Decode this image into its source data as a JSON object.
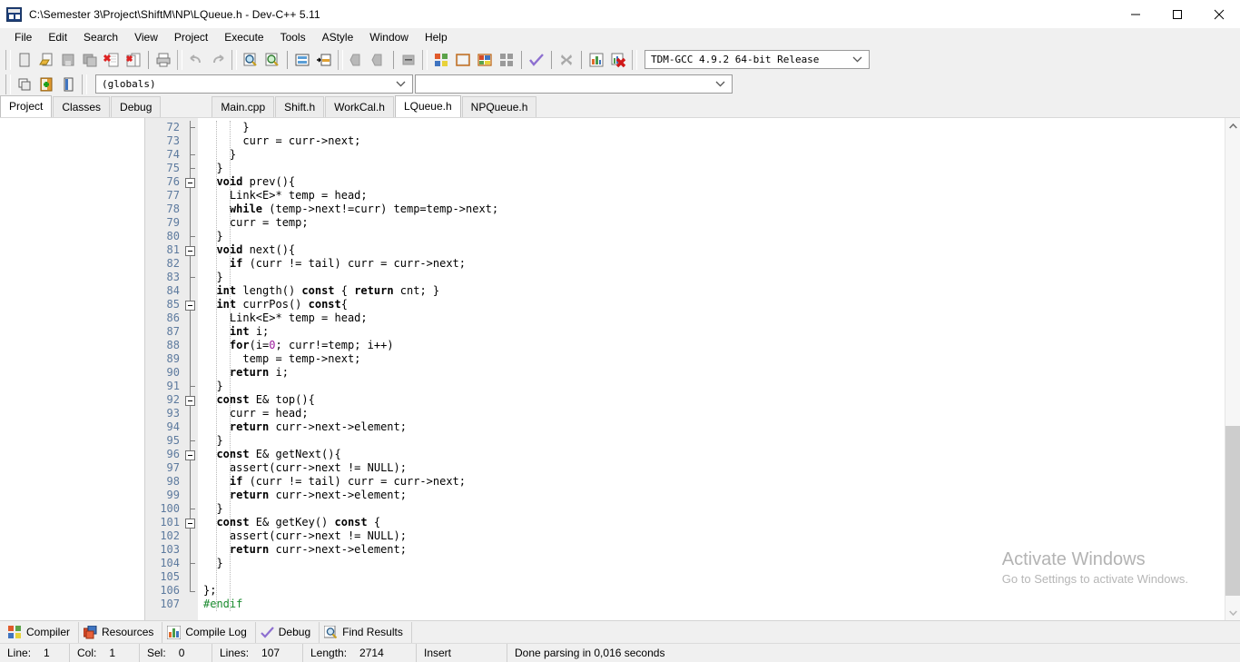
{
  "window": {
    "title": "C:\\Semester 3\\Project\\ShiftM\\NP\\LQueue.h - Dev-C++ 5.11",
    "app_icon": "devcpp-icon",
    "minimize": "minimize-icon",
    "maximize": "maximize-icon",
    "close": "close-icon"
  },
  "menu": {
    "items": [
      {
        "label": "File"
      },
      {
        "label": "Edit"
      },
      {
        "label": "Search"
      },
      {
        "label": "View"
      },
      {
        "label": "Project"
      },
      {
        "label": "Execute"
      },
      {
        "label": "Tools"
      },
      {
        "label": "AStyle"
      },
      {
        "label": "Window"
      },
      {
        "label": "Help"
      }
    ]
  },
  "toolbar1": {
    "buttons": [
      {
        "name": "new-file-icon"
      },
      {
        "name": "open-file-icon"
      },
      {
        "name": "save-file-icon"
      },
      {
        "name": "save-all-icon"
      },
      {
        "name": "close-file-icon"
      },
      {
        "name": "close-all-icon"
      },
      {
        "name": "print-icon"
      },
      {
        "name": "undo-icon"
      },
      {
        "name": "redo-icon"
      },
      {
        "name": "find-icon"
      },
      {
        "name": "replace-icon"
      },
      {
        "name": "goto-line-icon"
      },
      {
        "name": "goto-function-icon"
      },
      {
        "name": "back-icon"
      },
      {
        "name": "forward-icon"
      },
      {
        "name": "toggle-breakpoint-icon"
      },
      {
        "name": "compile-icon"
      },
      {
        "name": "run-icon"
      },
      {
        "name": "compile-and-run-icon"
      },
      {
        "name": "rebuild-all-icon"
      },
      {
        "name": "syntax-check-icon"
      },
      {
        "name": "stop-execution-icon"
      },
      {
        "name": "profile-icon"
      },
      {
        "name": "delete-profile-icon"
      }
    ]
  },
  "toolbar2": {
    "buttons": [
      {
        "name": "new-project-icon"
      },
      {
        "name": "add-to-project-icon"
      },
      {
        "name": "project-options-icon"
      }
    ],
    "scope_combo": {
      "value": "(globals)",
      "arrow": "chevron-down-icon"
    },
    "symbol_combo": {
      "value": "",
      "arrow": "chevron-down-icon"
    },
    "compiler_combo": {
      "value": "TDM-GCC 4.9.2 64-bit Release",
      "arrow": "chevron-down-icon"
    }
  },
  "panel_tabs": {
    "items": [
      {
        "label": "Project",
        "active": true
      },
      {
        "label": "Classes",
        "active": false
      },
      {
        "label": "Debug",
        "active": false
      }
    ]
  },
  "editor_tabs": {
    "items": [
      {
        "label": "Main.cpp",
        "active": false
      },
      {
        "label": "Shift.h",
        "active": false
      },
      {
        "label": "WorkCal.h",
        "active": false
      },
      {
        "label": "LQueue.h",
        "active": true
      },
      {
        "label": "NPQueue.h",
        "active": false
      }
    ]
  },
  "editor": {
    "first_line": 72,
    "lines": [
      {
        "n": 72,
        "fold": "tick",
        "tokens": [
          {
            "t": "      }",
            "c": "id"
          }
        ]
      },
      {
        "n": 73,
        "fold": "line",
        "tokens": [
          {
            "t": "      curr = curr->next;",
            "c": "id"
          }
        ]
      },
      {
        "n": 74,
        "fold": "tick",
        "tokens": [
          {
            "t": "    }",
            "c": "id"
          }
        ]
      },
      {
        "n": 75,
        "fold": "tick",
        "tokens": [
          {
            "t": "  }",
            "c": "id"
          }
        ]
      },
      {
        "n": 76,
        "fold": "box",
        "tokens": [
          {
            "t": "  ",
            "c": "id"
          },
          {
            "t": "void",
            "c": "kw"
          },
          {
            "t": " prev(){",
            "c": "id"
          }
        ]
      },
      {
        "n": 77,
        "fold": "line",
        "tokens": [
          {
            "t": "    Link<E>* temp = head;",
            "c": "id"
          }
        ]
      },
      {
        "n": 78,
        "fold": "line",
        "tokens": [
          {
            "t": "    ",
            "c": "id"
          },
          {
            "t": "while",
            "c": "kw"
          },
          {
            "t": " (temp->next!=curr) temp=temp->next;",
            "c": "id"
          }
        ]
      },
      {
        "n": 79,
        "fold": "line",
        "tokens": [
          {
            "t": "    curr = temp;",
            "c": "id"
          }
        ]
      },
      {
        "n": 80,
        "fold": "tick",
        "tokens": [
          {
            "t": "  }",
            "c": "id"
          }
        ]
      },
      {
        "n": 81,
        "fold": "box",
        "tokens": [
          {
            "t": "  ",
            "c": "id"
          },
          {
            "t": "void",
            "c": "kw"
          },
          {
            "t": " next(){",
            "c": "id"
          }
        ]
      },
      {
        "n": 82,
        "fold": "line",
        "tokens": [
          {
            "t": "    ",
            "c": "id"
          },
          {
            "t": "if",
            "c": "kw"
          },
          {
            "t": " (curr != tail) curr = curr->next;",
            "c": "id"
          }
        ]
      },
      {
        "n": 83,
        "fold": "tick",
        "tokens": [
          {
            "t": "  }",
            "c": "id"
          }
        ]
      },
      {
        "n": 84,
        "fold": "line",
        "tokens": [
          {
            "t": "  ",
            "c": "id"
          },
          {
            "t": "int",
            "c": "kw"
          },
          {
            "t": " length() ",
            "c": "id"
          },
          {
            "t": "const",
            "c": "kw"
          },
          {
            "t": " { ",
            "c": "id"
          },
          {
            "t": "return",
            "c": "kw"
          },
          {
            "t": " cnt; }",
            "c": "id"
          }
        ]
      },
      {
        "n": 85,
        "fold": "box",
        "tokens": [
          {
            "t": "  ",
            "c": "id"
          },
          {
            "t": "int",
            "c": "kw"
          },
          {
            "t": " currPos() ",
            "c": "id"
          },
          {
            "t": "const",
            "c": "kw"
          },
          {
            "t": "{",
            "c": "id"
          }
        ]
      },
      {
        "n": 86,
        "fold": "line",
        "tokens": [
          {
            "t": "    Link<E>* temp = head;",
            "c": "id"
          }
        ]
      },
      {
        "n": 87,
        "fold": "line",
        "tokens": [
          {
            "t": "    ",
            "c": "id"
          },
          {
            "t": "int",
            "c": "kw"
          },
          {
            "t": " i;",
            "c": "id"
          }
        ]
      },
      {
        "n": 88,
        "fold": "line",
        "tokens": [
          {
            "t": "    ",
            "c": "id"
          },
          {
            "t": "for",
            "c": "kw"
          },
          {
            "t": "(i=",
            "c": "id"
          },
          {
            "t": "0",
            "c": "num"
          },
          {
            "t": "; curr!=temp; i++)",
            "c": "id"
          }
        ]
      },
      {
        "n": 89,
        "fold": "line",
        "tokens": [
          {
            "t": "      temp = temp->next;",
            "c": "id"
          }
        ]
      },
      {
        "n": 90,
        "fold": "line",
        "tokens": [
          {
            "t": "    ",
            "c": "id"
          },
          {
            "t": "return",
            "c": "kw"
          },
          {
            "t": " i;",
            "c": "id"
          }
        ]
      },
      {
        "n": 91,
        "fold": "tick",
        "tokens": [
          {
            "t": "  }",
            "c": "id"
          }
        ]
      },
      {
        "n": 92,
        "fold": "box",
        "tokens": [
          {
            "t": "  ",
            "c": "id"
          },
          {
            "t": "const",
            "c": "kw"
          },
          {
            "t": " E& top(){",
            "c": "id"
          }
        ]
      },
      {
        "n": 93,
        "fold": "line",
        "tokens": [
          {
            "t": "    curr = head;",
            "c": "id"
          }
        ]
      },
      {
        "n": 94,
        "fold": "line",
        "tokens": [
          {
            "t": "    ",
            "c": "id"
          },
          {
            "t": "return",
            "c": "kw"
          },
          {
            "t": " curr->next->element;",
            "c": "id"
          }
        ]
      },
      {
        "n": 95,
        "fold": "tick",
        "tokens": [
          {
            "t": "  }",
            "c": "id"
          }
        ]
      },
      {
        "n": 96,
        "fold": "box",
        "tokens": [
          {
            "t": "  ",
            "c": "id"
          },
          {
            "t": "const",
            "c": "kw"
          },
          {
            "t": " E& getNext(){",
            "c": "id"
          }
        ]
      },
      {
        "n": 97,
        "fold": "line",
        "tokens": [
          {
            "t": "    assert(curr->next != NULL);",
            "c": "id"
          }
        ]
      },
      {
        "n": 98,
        "fold": "line",
        "tokens": [
          {
            "t": "    ",
            "c": "id"
          },
          {
            "t": "if",
            "c": "kw"
          },
          {
            "t": " (curr != tail) curr = curr->next;",
            "c": "id"
          }
        ]
      },
      {
        "n": 99,
        "fold": "line",
        "tokens": [
          {
            "t": "    ",
            "c": "id"
          },
          {
            "t": "return",
            "c": "kw"
          },
          {
            "t": " curr->next->element;",
            "c": "id"
          }
        ]
      },
      {
        "n": 100,
        "fold": "tick",
        "tokens": [
          {
            "t": "  }",
            "c": "id"
          }
        ]
      },
      {
        "n": 101,
        "fold": "box",
        "tokens": [
          {
            "t": "  ",
            "c": "id"
          },
          {
            "t": "const",
            "c": "kw"
          },
          {
            "t": " E& getKey() ",
            "c": "id"
          },
          {
            "t": "const",
            "c": "kw"
          },
          {
            "t": " {",
            "c": "id"
          }
        ]
      },
      {
        "n": 102,
        "fold": "line",
        "tokens": [
          {
            "t": "    assert(curr->next != NULL);",
            "c": "id"
          }
        ]
      },
      {
        "n": 103,
        "fold": "line",
        "tokens": [
          {
            "t": "    ",
            "c": "id"
          },
          {
            "t": "return",
            "c": "kw"
          },
          {
            "t": " curr->next->element;",
            "c": "id"
          }
        ]
      },
      {
        "n": 104,
        "fold": "tick",
        "tokens": [
          {
            "t": "  }",
            "c": "id"
          }
        ]
      },
      {
        "n": 105,
        "fold": "line",
        "tokens": [
          {
            "t": "",
            "c": "id"
          }
        ]
      },
      {
        "n": 106,
        "fold": "end",
        "tokens": [
          {
            "t": "};",
            "c": "id"
          }
        ]
      },
      {
        "n": 107,
        "fold": "none",
        "tokens": [
          {
            "t": "#endif",
            "c": "pre"
          }
        ]
      }
    ]
  },
  "scrollbar": {
    "up_arrow": "chevron-up-icon",
    "down_arrow": "chevron-down-icon",
    "thumb_top_pct": 62,
    "thumb_height_pct": 36
  },
  "watermark": {
    "line1": "Activate Windows",
    "line2": "Go to Settings to activate Windows."
  },
  "bottom_tabs": {
    "items": [
      {
        "label": "Compiler",
        "icon": "compiler-icon"
      },
      {
        "label": "Resources",
        "icon": "resources-icon"
      },
      {
        "label": "Compile Log",
        "icon": "compile-log-icon"
      },
      {
        "label": "Debug",
        "icon": "debug-check-icon"
      },
      {
        "label": "Find Results",
        "icon": "find-results-icon"
      }
    ]
  },
  "statusbar": {
    "line_label": "Line:",
    "line_value": "1",
    "col_label": "Col:",
    "col_value": "1",
    "sel_label": "Sel:",
    "sel_value": "0",
    "lines_label": "Lines:",
    "lines_value": "107",
    "length_label": "Length:",
    "length_value": "2714",
    "mode": "Insert",
    "message": "Done parsing in 0,016 seconds"
  },
  "colors": {
    "window_bg": "#f0f0f0",
    "editor_bg": "#ffffff",
    "gutter_bg": "#ececec",
    "line_number": "#5d7a9e",
    "keyword": "#000000",
    "number": "#9b1a9b",
    "preprocessor": "#1a8a2e",
    "scroll_thumb": "#cdcdcd",
    "watermark": "#b3b3b3"
  }
}
